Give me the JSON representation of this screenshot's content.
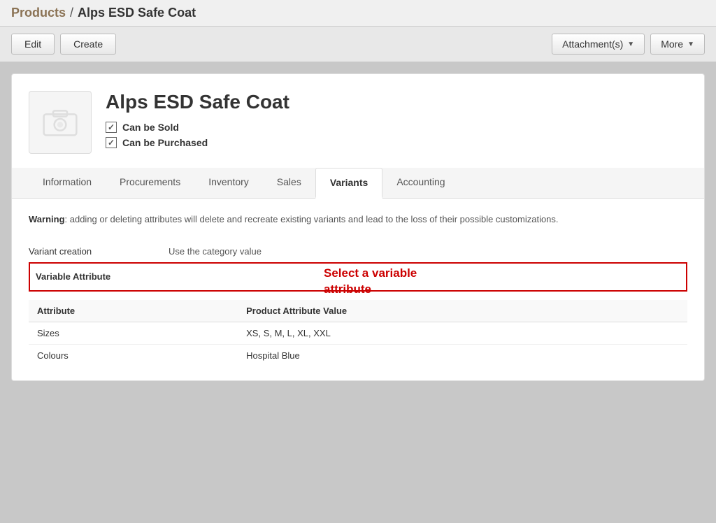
{
  "breadcrumb": {
    "products_label": "Products",
    "separator": "/",
    "current_page": "Alps ESD Safe Coat"
  },
  "toolbar": {
    "edit_label": "Edit",
    "create_label": "Create",
    "attachments_label": "Attachment(s)",
    "more_label": "More"
  },
  "product": {
    "name": "Alps ESD Safe Coat",
    "can_be_sold": "Can be Sold",
    "can_be_purchased": "Can be Purchased",
    "image_alt": "Product image placeholder"
  },
  "tabs": [
    {
      "id": "information",
      "label": "Information",
      "active": false
    },
    {
      "id": "procurements",
      "label": "Procurements",
      "active": false
    },
    {
      "id": "inventory",
      "label": "Inventory",
      "active": false
    },
    {
      "id": "sales",
      "label": "Sales",
      "active": false
    },
    {
      "id": "variants",
      "label": "Variants",
      "active": true
    },
    {
      "id": "accounting",
      "label": "Accounting",
      "active": false
    }
  ],
  "variants_tab": {
    "warning_label": "Warning",
    "warning_text": ": adding or deleting attributes will delete and recreate existing variants and lead to the loss of their possible customizations.",
    "variant_creation_label": "Variant creation",
    "variant_creation_value": "Use the category value",
    "variable_attribute_label": "Variable Attribute",
    "select_hint": "Select a variable\nattribute",
    "attr_table": {
      "col_attribute": "Attribute",
      "col_value": "Product Attribute Value",
      "rows": [
        {
          "attribute": "Sizes",
          "value": "XS, S, M, L, XL, XXL"
        },
        {
          "attribute": "Colours",
          "value": "Hospital Blue"
        }
      ]
    }
  }
}
